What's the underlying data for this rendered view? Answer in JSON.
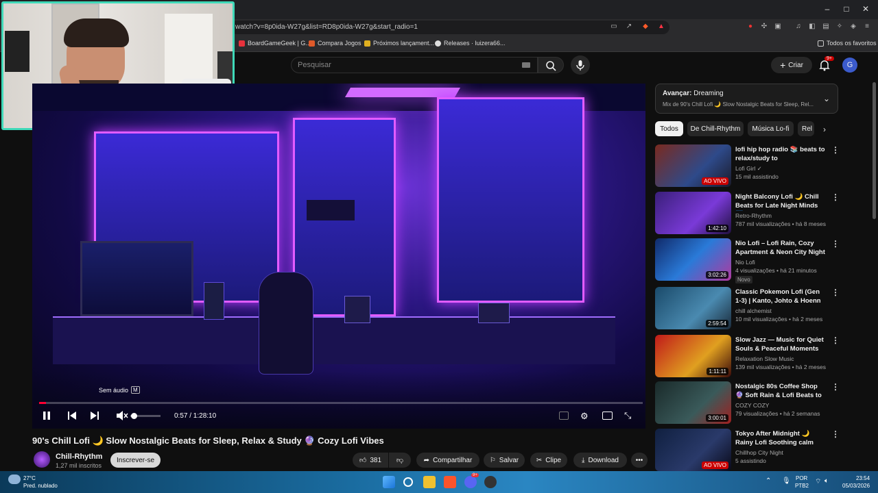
{
  "browser": {
    "url": "watch?v=8p0ida-W27g&list=RD8p0ida-W27g&start_radio=1",
    "bookmarks": [
      "BoardGameGeek | G...",
      "Compara Jogos",
      "Próximos lançament...",
      "Releases · luizera66..."
    ],
    "favorites_label": "Todos os favoritos",
    "win_minimize": "–",
    "win_maximize": "□",
    "win_close": "✕"
  },
  "header": {
    "search_placeholder": "Pesquisar",
    "create_label": "Criar",
    "notif_count": "9+",
    "avatar_letter": "G"
  },
  "player": {
    "muted_tooltip": "Sem áudio",
    "muted_key": "M",
    "time": "0:57 / 1:28:10",
    "progress_fraction": 0.011
  },
  "video": {
    "title": "90's Chill Lofi 🌙 Slow Nostalgic Beats for Sleep, Relax & Study 🔮 Cozy Lofi Vibes",
    "channel": "Chill-Rhythm",
    "subscribers": "1,27 mil inscritos",
    "subscribe_label": "Inscrever-se",
    "likes": "381",
    "share_label": "Compartilhar",
    "save_label": "Salvar",
    "clip_label": "Clipe",
    "download_label": "Download"
  },
  "up_next": {
    "label": "Avançar:",
    "title": "Dreaming",
    "subtitle": "Mix de 90's Chill Lofi 🌙 Slow Nostalgic Beats for Sleep, Rel..."
  },
  "chips": [
    "Todos",
    "De Chill-Rhythm",
    "Música Lo-fi",
    "Rel"
  ],
  "recommendations": [
    {
      "title": "lofi hip hop radio 📚 beats to relax/study to",
      "channel": "Lofi Girl ✓",
      "meta": "15 mil assistindo",
      "badge": "AO VIVO",
      "live": true,
      "new": ""
    },
    {
      "title": "Night Balcony Lofi 🌙 Chill Beats for Late Night Minds 🌃 ...",
      "channel": "Retro-Rhythm",
      "meta": "787 mil visualizações • há 8 meses",
      "badge": "1:42:10",
      "live": false,
      "new": ""
    },
    {
      "title": "Nio Lofi – Lofi Rain, Cozy Apartment & Neon City Night ...",
      "channel": "Nio Lofi",
      "meta": "4 visualizações • há 21 minutos",
      "badge": "3:02:26",
      "live": false,
      "new": "Novo"
    },
    {
      "title": "Classic Pokemon Lofi (Gen 1-3) | Kanto, Johto & Hoenn Vibes",
      "channel": "chill alchemist",
      "meta": "10 mil visualizações • há 2 meses",
      "badge": "2:59:54",
      "live": false,
      "new": ""
    },
    {
      "title": "Slow Jazz — Music for Quiet Souls & Peaceful Moments",
      "channel": "Relaxation Slow Music",
      "meta": "139 mil visualizações • há 2 meses",
      "badge": "1:11:11",
      "live": false,
      "new": ""
    },
    {
      "title": "Nostalgic 80s Coffee Shop 🔮 Soft Rain & Lofi Beats to Stay ...",
      "channel": "COZY COZY",
      "meta": "79 visualizações • há 2 semanas",
      "badge": "3:00:01",
      "live": false,
      "new": ""
    },
    {
      "title": "Tokyo After Midnight 🌙 Rainy Lofi Soothing calm your mind ...",
      "channel": "Chillhop City Night",
      "meta": "5 assistindo",
      "badge": "AO VIVO",
      "live": true,
      "new": ""
    }
  ],
  "taskbar": {
    "weather_temp": "27°C",
    "weather_desc": "Pred. nublado",
    "lang_top": "POR",
    "lang_bottom": "PTB2",
    "time": "23:54",
    "date": "05/03/2026",
    "discord_badge": "9+"
  }
}
